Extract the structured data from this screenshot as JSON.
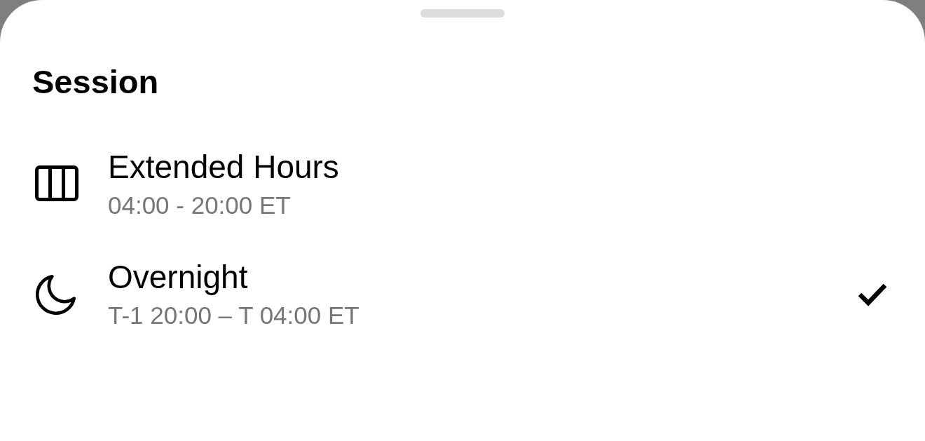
{
  "sheet": {
    "title": "Session"
  },
  "options": [
    {
      "kind": "columns",
      "label": "Extended Hours",
      "hours": "04:00 - 20:00 ET",
      "selected": false
    },
    {
      "kind": "moon",
      "label": "Overnight",
      "hours": "T-1 20:00 – T 04:00 ET",
      "selected": true
    }
  ]
}
